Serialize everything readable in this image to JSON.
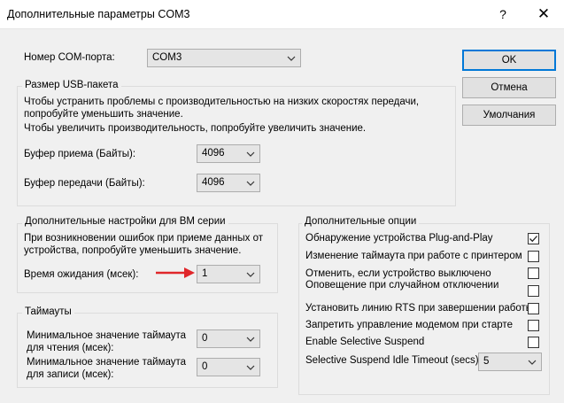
{
  "window": {
    "title": "Дополнительные параметры COM3",
    "help_glyph": "?",
    "close_glyph": "✕"
  },
  "port": {
    "label": "Номер COM-порта:",
    "value": "COM3"
  },
  "buttons": {
    "ok": "OK",
    "cancel": "Отмена",
    "defaults": "Умолчания"
  },
  "usb": {
    "group_label": "Размер USB-пакета",
    "desc_line1": "Чтобы устранить проблемы с производительностью на низких скоростях передачи,",
    "desc_line2": "попробуйте уменьшить значение.",
    "desc_line3": "Чтобы увеличить производительность, попробуйте увеличить значение.",
    "rx_label": "Буфер приема (Байты):",
    "rx_value": "4096",
    "tx_label": "Буфер передачи (Байты):",
    "tx_value": "4096"
  },
  "bm": {
    "group_label": "Дополнительные настройки для BM серии",
    "desc_line1": "При возникновении ошибок при приеме данных от",
    "desc_line2": "устройства, попробуйте уменьшить значение.",
    "latency_label": "Время ожидания (мсек):",
    "latency_value": "1"
  },
  "timeouts": {
    "group_label": "Таймауты",
    "read_label_line1": "Минимальное значение таймаута",
    "read_label_line2": "для чтения (мсек):",
    "read_value": "0",
    "write_label_line1": "Минимальное значение таймаута",
    "write_label_line2": "для записи (мсек):",
    "write_value": "0"
  },
  "options": {
    "group_label": "Дополнительные опции",
    "items": [
      {
        "label": "Обнаружение устройства Plug-and-Play",
        "checked": true
      },
      {
        "label": "Изменение таймаута при работе с принтером",
        "checked": false
      },
      {
        "label": "Отменить, если устройство выключено",
        "checked": false
      },
      {
        "label": "Оповещение при случайном отключении устройства",
        "checked": false
      },
      {
        "label": "Установить линию RTS при завершении работы",
        "checked": false
      },
      {
        "label": "Запретить управление модемом при старте",
        "checked": false
      },
      {
        "label": "Enable Selective Suspend",
        "checked": false
      }
    ],
    "idle_label": "Selective Suspend Idle Timeout (secs):",
    "idle_value": "5"
  },
  "colors": {
    "accent": "#0078d7",
    "annotation_arrow": "#e0262a"
  }
}
